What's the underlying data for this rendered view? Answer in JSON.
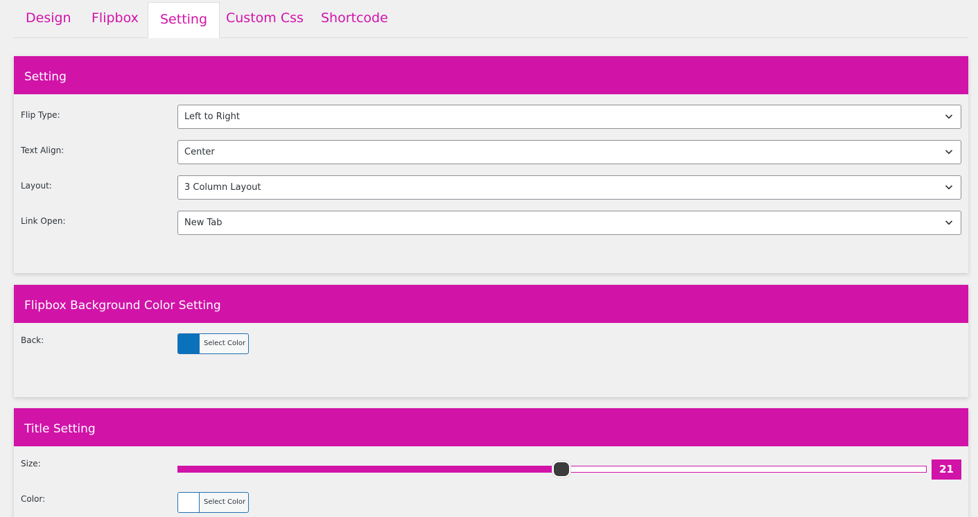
{
  "tabs": [
    {
      "label": "Design",
      "active": false
    },
    {
      "label": "Flipbox",
      "active": false
    },
    {
      "label": "Setting",
      "active": true
    },
    {
      "label": "Custom Css",
      "active": false
    },
    {
      "label": "Shortcode",
      "active": false
    }
  ],
  "setting_panel": {
    "title": "Setting",
    "fields": [
      {
        "label": "Flip Type:",
        "value": "Left to Right"
      },
      {
        "label": "Text Align:",
        "value": "Center"
      },
      {
        "label": "Layout:",
        "value": "3 Column Layout"
      },
      {
        "label": "Link Open:",
        "value": "New Tab"
      }
    ]
  },
  "bg_panel": {
    "title": "Flipbox Background Color Setting",
    "back": {
      "label": "Back:",
      "button_label": "Select Color",
      "color": "#0a72bb"
    }
  },
  "title_panel": {
    "title": "Title Setting",
    "size": {
      "label": "Size:",
      "value": "21",
      "fraction": 0.5125
    },
    "color": {
      "label": "Color:",
      "button_label": "Select Color",
      "color": "#ffffff"
    }
  },
  "colors": {
    "accent": "#d113a8",
    "color_button_border": "#2271b1"
  },
  "icons": {
    "select_arrow": "chevron-down-icon"
  }
}
